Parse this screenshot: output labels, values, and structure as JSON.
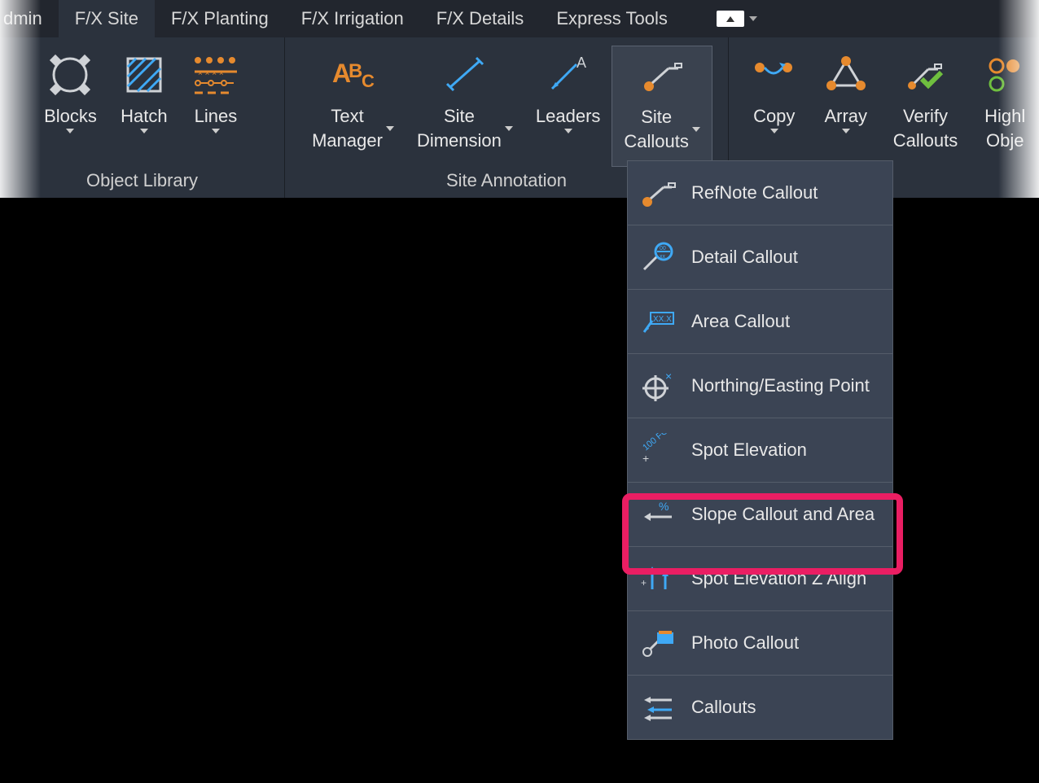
{
  "tabs": {
    "admin": "dmin",
    "fx_site": "F/X Site",
    "fx_planting": "F/X Planting",
    "fx_irrigation": "F/X Irrigation",
    "fx_details": "F/X Details",
    "express_tools": "Express Tools"
  },
  "panels": {
    "object_library": {
      "title": "Object Library",
      "blocks": "Blocks",
      "hatch": "Hatch",
      "lines": "Lines"
    },
    "site_annotation": {
      "title": "Site Annotation",
      "text_manager": "Text\nManager",
      "site_dimension": "Site\nDimension",
      "leaders": "Leaders",
      "site_callouts": "Site\nCallouts"
    },
    "right": {
      "copy": "Copy",
      "array": "Array",
      "verify_callouts": "Verify\nCallouts",
      "highlight": "Highl",
      "object": "Obje"
    }
  },
  "dropdown": {
    "refnote_callout": "RefNote Callout",
    "detail_callout": "Detail Callout",
    "area_callout": "Area Callout",
    "northing_easting": "Northing/Easting Point",
    "spot_elevation": "Spot Elevation",
    "slope_callout": "Slope Callout and Area",
    "spot_z_align": "Spot Elevation Z Align",
    "photo_callout": "Photo Callout",
    "callouts": "Callouts"
  },
  "colors": {
    "orange": "#e68a2e",
    "blue": "#3fa9f5",
    "green": "#6fbf3f"
  }
}
